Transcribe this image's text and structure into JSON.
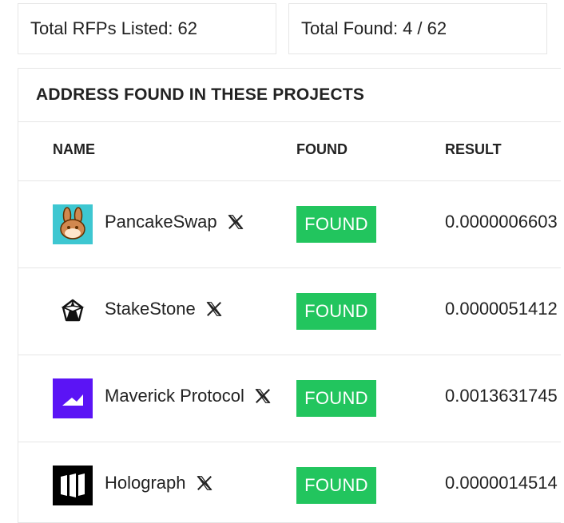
{
  "stats": {
    "total_rfps_label": "Total RFPs Listed:",
    "total_rfps_value": "62",
    "total_found_label": "Total Found:",
    "total_found_value": "4 / 62"
  },
  "panel": {
    "title": "ADDRESS FOUND IN THESE PROJECTS",
    "columns": {
      "name": "NAME",
      "found": "FOUND",
      "result": "RESULT"
    }
  },
  "rows": [
    {
      "name": "PancakeSwap",
      "status": "FOUND",
      "result": "0.0000006603",
      "logo": "pancakeswap-logo",
      "icon": "x-icon"
    },
    {
      "name": "StakeStone",
      "status": "FOUND",
      "result": "0.0000051412",
      "logo": "stakestone-logo",
      "icon": "x-icon"
    },
    {
      "name": "Maverick Protocol",
      "status": "FOUND",
      "result": "0.0013631745",
      "logo": "maverick-logo",
      "icon": "x-icon"
    },
    {
      "name": "Holograph",
      "status": "FOUND",
      "result": "0.0000014514",
      "logo": "holograph-logo",
      "icon": "x-icon"
    }
  ],
  "colors": {
    "found_badge": "#22c55e",
    "border": "#e6e6e6",
    "maverick": "#5b14f5",
    "pancake_bg": "#3ec7d1"
  }
}
